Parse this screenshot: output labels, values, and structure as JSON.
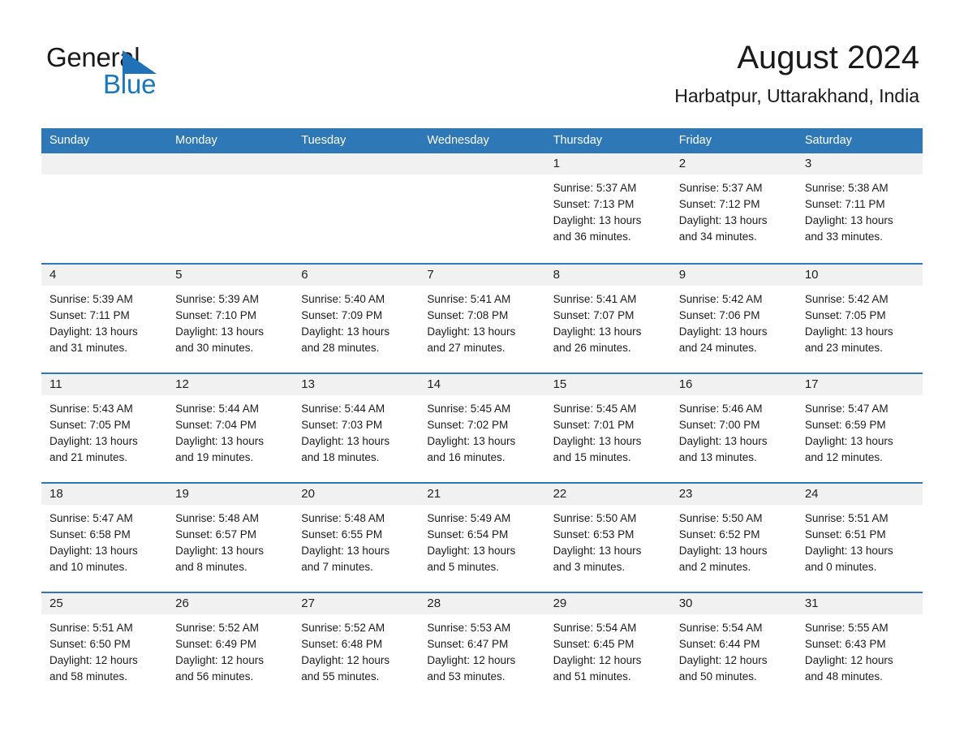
{
  "brand": {
    "name_part1": "General",
    "name_part2": "Blue",
    "triangle_icon": "triangle-icon",
    "accent_color": "#1878bd"
  },
  "header": {
    "title": "August 2024",
    "subtitle": "Harbatpur, Uttarakhand, India"
  },
  "theme": {
    "header_blue": "#2e78b8",
    "day_band_gray": "#f1f1f1",
    "text_dark": "#1a1a1a"
  },
  "weekdays": [
    "Sunday",
    "Monday",
    "Tuesday",
    "Wednesday",
    "Thursday",
    "Friday",
    "Saturday"
  ],
  "weeks": [
    [
      {
        "day": "",
        "sunrise": "",
        "sunset": "",
        "daylight_line1": "",
        "daylight_line2": ""
      },
      {
        "day": "",
        "sunrise": "",
        "sunset": "",
        "daylight_line1": "",
        "daylight_line2": ""
      },
      {
        "day": "",
        "sunrise": "",
        "sunset": "",
        "daylight_line1": "",
        "daylight_line2": ""
      },
      {
        "day": "",
        "sunrise": "",
        "sunset": "",
        "daylight_line1": "",
        "daylight_line2": ""
      },
      {
        "day": "1",
        "sunrise": "Sunrise: 5:37 AM",
        "sunset": "Sunset: 7:13 PM",
        "daylight_line1": "Daylight: 13 hours",
        "daylight_line2": "and 36 minutes."
      },
      {
        "day": "2",
        "sunrise": "Sunrise: 5:37 AM",
        "sunset": "Sunset: 7:12 PM",
        "daylight_line1": "Daylight: 13 hours",
        "daylight_line2": "and 34 minutes."
      },
      {
        "day": "3",
        "sunrise": "Sunrise: 5:38 AM",
        "sunset": "Sunset: 7:11 PM",
        "daylight_line1": "Daylight: 13 hours",
        "daylight_line2": "and 33 minutes."
      }
    ],
    [
      {
        "day": "4",
        "sunrise": "Sunrise: 5:39 AM",
        "sunset": "Sunset: 7:11 PM",
        "daylight_line1": "Daylight: 13 hours",
        "daylight_line2": "and 31 minutes."
      },
      {
        "day": "5",
        "sunrise": "Sunrise: 5:39 AM",
        "sunset": "Sunset: 7:10 PM",
        "daylight_line1": "Daylight: 13 hours",
        "daylight_line2": "and 30 minutes."
      },
      {
        "day": "6",
        "sunrise": "Sunrise: 5:40 AM",
        "sunset": "Sunset: 7:09 PM",
        "daylight_line1": "Daylight: 13 hours",
        "daylight_line2": "and 28 minutes."
      },
      {
        "day": "7",
        "sunrise": "Sunrise: 5:41 AM",
        "sunset": "Sunset: 7:08 PM",
        "daylight_line1": "Daylight: 13 hours",
        "daylight_line2": "and 27 minutes."
      },
      {
        "day": "8",
        "sunrise": "Sunrise: 5:41 AM",
        "sunset": "Sunset: 7:07 PM",
        "daylight_line1": "Daylight: 13 hours",
        "daylight_line2": "and 26 minutes."
      },
      {
        "day": "9",
        "sunrise": "Sunrise: 5:42 AM",
        "sunset": "Sunset: 7:06 PM",
        "daylight_line1": "Daylight: 13 hours",
        "daylight_line2": "and 24 minutes."
      },
      {
        "day": "10",
        "sunrise": "Sunrise: 5:42 AM",
        "sunset": "Sunset: 7:05 PM",
        "daylight_line1": "Daylight: 13 hours",
        "daylight_line2": "and 23 minutes."
      }
    ],
    [
      {
        "day": "11",
        "sunrise": "Sunrise: 5:43 AM",
        "sunset": "Sunset: 7:05 PM",
        "daylight_line1": "Daylight: 13 hours",
        "daylight_line2": "and 21 minutes."
      },
      {
        "day": "12",
        "sunrise": "Sunrise: 5:44 AM",
        "sunset": "Sunset: 7:04 PM",
        "daylight_line1": "Daylight: 13 hours",
        "daylight_line2": "and 19 minutes."
      },
      {
        "day": "13",
        "sunrise": "Sunrise: 5:44 AM",
        "sunset": "Sunset: 7:03 PM",
        "daylight_line1": "Daylight: 13 hours",
        "daylight_line2": "and 18 minutes."
      },
      {
        "day": "14",
        "sunrise": "Sunrise: 5:45 AM",
        "sunset": "Sunset: 7:02 PM",
        "daylight_line1": "Daylight: 13 hours",
        "daylight_line2": "and 16 minutes."
      },
      {
        "day": "15",
        "sunrise": "Sunrise: 5:45 AM",
        "sunset": "Sunset: 7:01 PM",
        "daylight_line1": "Daylight: 13 hours",
        "daylight_line2": "and 15 minutes."
      },
      {
        "day": "16",
        "sunrise": "Sunrise: 5:46 AM",
        "sunset": "Sunset: 7:00 PM",
        "daylight_line1": "Daylight: 13 hours",
        "daylight_line2": "and 13 minutes."
      },
      {
        "day": "17",
        "sunrise": "Sunrise: 5:47 AM",
        "sunset": "Sunset: 6:59 PM",
        "daylight_line1": "Daylight: 13 hours",
        "daylight_line2": "and 12 minutes."
      }
    ],
    [
      {
        "day": "18",
        "sunrise": "Sunrise: 5:47 AM",
        "sunset": "Sunset: 6:58 PM",
        "daylight_line1": "Daylight: 13 hours",
        "daylight_line2": "and 10 minutes."
      },
      {
        "day": "19",
        "sunrise": "Sunrise: 5:48 AM",
        "sunset": "Sunset: 6:57 PM",
        "daylight_line1": "Daylight: 13 hours",
        "daylight_line2": "and 8 minutes."
      },
      {
        "day": "20",
        "sunrise": "Sunrise: 5:48 AM",
        "sunset": "Sunset: 6:55 PM",
        "daylight_line1": "Daylight: 13 hours",
        "daylight_line2": "and 7 minutes."
      },
      {
        "day": "21",
        "sunrise": "Sunrise: 5:49 AM",
        "sunset": "Sunset: 6:54 PM",
        "daylight_line1": "Daylight: 13 hours",
        "daylight_line2": "and 5 minutes."
      },
      {
        "day": "22",
        "sunrise": "Sunrise: 5:50 AM",
        "sunset": "Sunset: 6:53 PM",
        "daylight_line1": "Daylight: 13 hours",
        "daylight_line2": "and 3 minutes."
      },
      {
        "day": "23",
        "sunrise": "Sunrise: 5:50 AM",
        "sunset": "Sunset: 6:52 PM",
        "daylight_line1": "Daylight: 13 hours",
        "daylight_line2": "and 2 minutes."
      },
      {
        "day": "24",
        "sunrise": "Sunrise: 5:51 AM",
        "sunset": "Sunset: 6:51 PM",
        "daylight_line1": "Daylight: 13 hours",
        "daylight_line2": "and 0 minutes."
      }
    ],
    [
      {
        "day": "25",
        "sunrise": "Sunrise: 5:51 AM",
        "sunset": "Sunset: 6:50 PM",
        "daylight_line1": "Daylight: 12 hours",
        "daylight_line2": "and 58 minutes."
      },
      {
        "day": "26",
        "sunrise": "Sunrise: 5:52 AM",
        "sunset": "Sunset: 6:49 PM",
        "daylight_line1": "Daylight: 12 hours",
        "daylight_line2": "and 56 minutes."
      },
      {
        "day": "27",
        "sunrise": "Sunrise: 5:52 AM",
        "sunset": "Sunset: 6:48 PM",
        "daylight_line1": "Daylight: 12 hours",
        "daylight_line2": "and 55 minutes."
      },
      {
        "day": "28",
        "sunrise": "Sunrise: 5:53 AM",
        "sunset": "Sunset: 6:47 PM",
        "daylight_line1": "Daylight: 12 hours",
        "daylight_line2": "and 53 minutes."
      },
      {
        "day": "29",
        "sunrise": "Sunrise: 5:54 AM",
        "sunset": "Sunset: 6:45 PM",
        "daylight_line1": "Daylight: 12 hours",
        "daylight_line2": "and 51 minutes."
      },
      {
        "day": "30",
        "sunrise": "Sunrise: 5:54 AM",
        "sunset": "Sunset: 6:44 PM",
        "daylight_line1": "Daylight: 12 hours",
        "daylight_line2": "and 50 minutes."
      },
      {
        "day": "31",
        "sunrise": "Sunrise: 5:55 AM",
        "sunset": "Sunset: 6:43 PM",
        "daylight_line1": "Daylight: 12 hours",
        "daylight_line2": "and 48 minutes."
      }
    ]
  ]
}
